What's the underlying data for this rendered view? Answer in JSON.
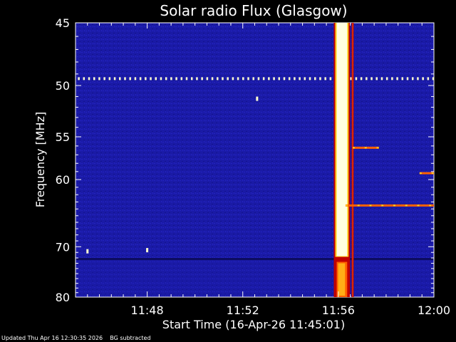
{
  "chart_data": {
    "type": "heatmap",
    "title": "Solar radio Flux (Glasgow)",
    "xlabel": "Start Time (16-Apr-26 11:45:01)",
    "ylabel": "Frequency [MHz]",
    "x_ticks": [
      "11:48",
      "11:52",
      "11:56",
      "12:00"
    ],
    "x_tick_minutes": [
      3,
      7,
      11,
      15
    ],
    "x_range_minutes": [
      0,
      15
    ],
    "y_scale": "log",
    "y_ticks": [
      45,
      50,
      55,
      60,
      70,
      80
    ],
    "y_range_mhz": [
      45,
      80
    ],
    "colormap": [
      "#1c1ca8",
      "#3030d8",
      "#c00000",
      "#ff6000",
      "#ffd020",
      "#ffffe0"
    ],
    "background_color": "#1a1aa6",
    "features": [
      {
        "name": "interference line",
        "type": "dotted-horizontal",
        "freq_mhz": 49.4,
        "t_start": 0,
        "t_end": 15
      },
      {
        "name": "dark horizontal band",
        "type": "band",
        "freq_mhz": 72.2
      },
      {
        "name": "main burst",
        "type": "vertical-burst",
        "t_start": 10.9,
        "t_end": 11.4,
        "freq_range": [
          45,
          80
        ],
        "intensity": "very-high"
      },
      {
        "name": "secondary burst",
        "type": "vertical-line",
        "t": 11.6,
        "freq_range": [
          45,
          80
        ],
        "intensity": "medium"
      },
      {
        "name": "line 56 MHz",
        "type": "horizontal-segment",
        "freq_mhz": 56.2,
        "t_start": 11.6,
        "t_end": 12.7
      },
      {
        "name": "line 63 MHz",
        "type": "horizontal-segment",
        "freq_mhz": 63.5,
        "t_start": 11.3,
        "t_end": 15
      },
      {
        "name": "line 59 MHz",
        "type": "horizontal-segment",
        "freq_mhz": 59.2,
        "t_start": 14.4,
        "t_end": 15
      },
      {
        "name": "spot",
        "type": "spot",
        "t": 7.6,
        "freq_mhz": 51.2
      },
      {
        "name": "spot",
        "type": "spot",
        "t": 0.5,
        "freq_mhz": 70.8
      },
      {
        "name": "spot",
        "type": "spot",
        "t": 3.0,
        "freq_mhz": 70.6
      }
    ]
  },
  "footer": "Updated Thu Apr 16 12:30:35 2026    BG subtracted"
}
